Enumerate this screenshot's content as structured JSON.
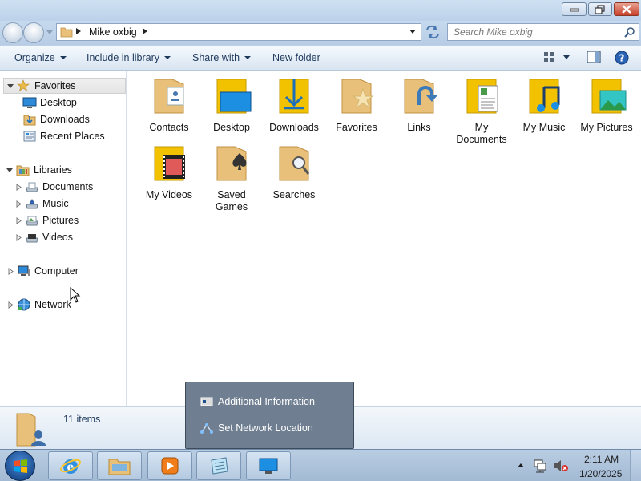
{
  "window": {
    "controls": {
      "minimize": "minimize",
      "maximize": "maximize",
      "close": "close"
    }
  },
  "address": {
    "path": "Mike oxbig",
    "search_placeholder": "Search Mike oxbig"
  },
  "toolbar": {
    "organize": "Organize",
    "include_in_library": "Include in library",
    "share_with": "Share with",
    "new_folder": "New folder"
  },
  "navpane": {
    "favorites": {
      "label": "Favorites",
      "items": [
        "Desktop",
        "Downloads",
        "Recent Places"
      ]
    },
    "libraries": {
      "label": "Libraries",
      "items": [
        "Documents",
        "Music",
        "Pictures",
        "Videos"
      ]
    },
    "computer": "Computer",
    "network": "Network"
  },
  "folders": [
    {
      "label": "Contacts",
      "icon": "contacts-folder-icon"
    },
    {
      "label": "Desktop",
      "icon": "desktop-folder-icon"
    },
    {
      "label": "Downloads",
      "icon": "downloads-folder-icon"
    },
    {
      "label": "Favorites",
      "icon": "favorites-folder-icon"
    },
    {
      "label": "Links",
      "icon": "links-folder-icon"
    },
    {
      "label": "My Documents",
      "icon": "documents-folder-icon"
    },
    {
      "label": "My Music",
      "icon": "music-folder-icon"
    },
    {
      "label": "My Pictures",
      "icon": "pictures-folder-icon"
    },
    {
      "label": "My Videos",
      "icon": "videos-folder-icon"
    },
    {
      "label": "Saved Games",
      "icon": "saved-games-folder-icon"
    },
    {
      "label": "Searches",
      "icon": "searches-folder-icon"
    }
  ],
  "details": {
    "count": "11 items"
  },
  "popup": {
    "items": [
      "Additional Information",
      "Set Network Location"
    ]
  },
  "taskbar": {
    "time": "2:11 AM",
    "date": "1/20/2025"
  },
  "colors": {
    "folder": "#e8c07a",
    "accent": "#1e395b"
  }
}
